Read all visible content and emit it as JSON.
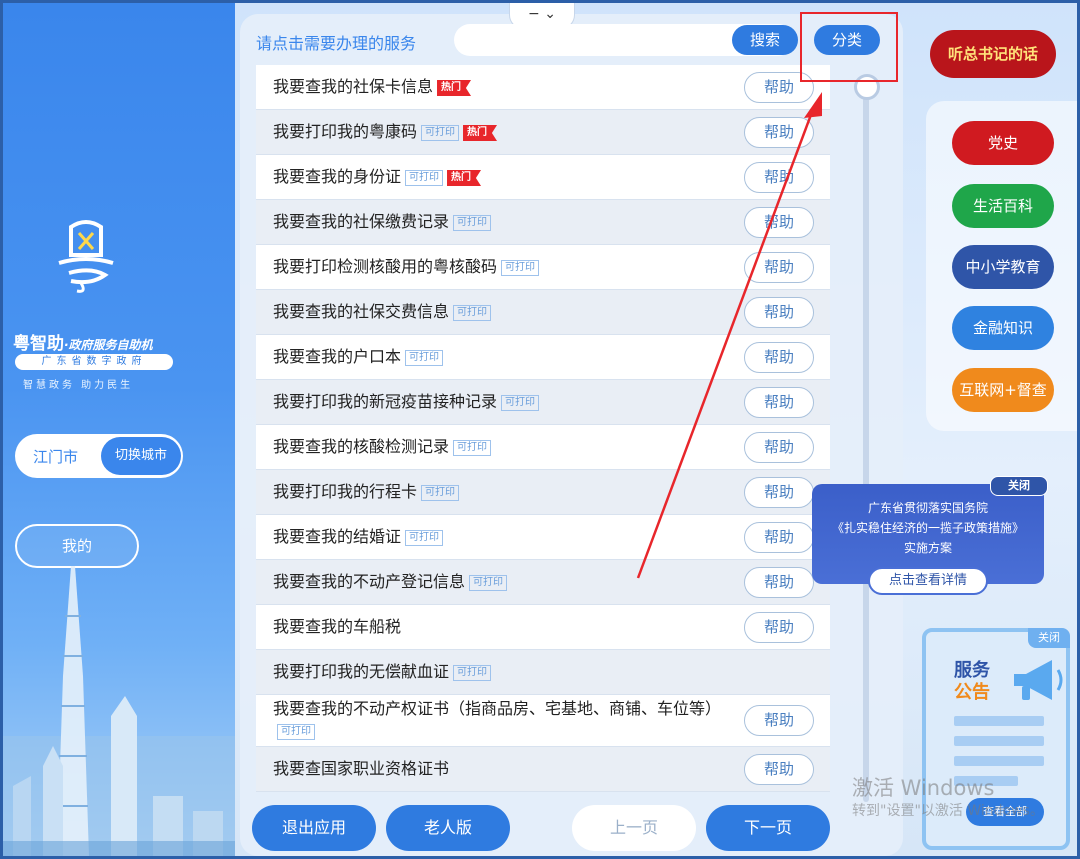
{
  "left": {
    "brand_name": "粤智助",
    "brand_suffix": "·政府服务自助机",
    "brand_sub": "广东省数字政府",
    "brand_slogan": "智慧政务  助力民生",
    "city": "江门市",
    "switch_city": "切换城市",
    "mine": "我的"
  },
  "header": {
    "collapse_glyphs": "−  ⌄",
    "prompt": "请点击需要办理的服务",
    "search_value": "",
    "search_label": "搜索",
    "category_label": "分类"
  },
  "tags": {
    "print": "可打印",
    "hot": "热门"
  },
  "help_label": "帮助",
  "services": [
    {
      "text": "我要查我的社保卡信息",
      "print": false,
      "hot": true,
      "help": true
    },
    {
      "text": "我要打印我的粤康码",
      "print": true,
      "hot": true,
      "help": true
    },
    {
      "text": "我要查我的身份证",
      "print": true,
      "hot": true,
      "help": true
    },
    {
      "text": "我要查我的社保缴费记录",
      "print": true,
      "hot": false,
      "help": true
    },
    {
      "text": "我要打印检测核酸用的粤核酸码",
      "print": true,
      "hot": false,
      "help": true
    },
    {
      "text": "我要查我的社保交费信息",
      "print": true,
      "hot": false,
      "help": true
    },
    {
      "text": "我要查我的户口本",
      "print": true,
      "hot": false,
      "help": true
    },
    {
      "text": "我要打印我的新冠疫苗接种记录",
      "print": true,
      "hot": false,
      "help": true
    },
    {
      "text": "我要查我的核酸检测记录",
      "print": true,
      "hot": false,
      "help": true
    },
    {
      "text": "我要打印我的行程卡",
      "print": true,
      "hot": false,
      "help": true
    },
    {
      "text": "我要查我的结婚证",
      "print": true,
      "hot": false,
      "help": true
    },
    {
      "text": "我要查我的不动产登记信息",
      "print": true,
      "hot": false,
      "help": true
    },
    {
      "text": "我要查我的车船税",
      "print": false,
      "hot": false,
      "help": true
    },
    {
      "text": "我要打印我的无偿献血证",
      "print": true,
      "hot": false,
      "help": false
    },
    {
      "text": "我要查我的不动产权证书（指商品房、宅基地、商铺、车位等）",
      "print": true,
      "hot": false,
      "help": true,
      "tall": true
    },
    {
      "text": "我要查国家职业资格证书",
      "print": false,
      "hot": false,
      "help": true
    }
  ],
  "footer": {
    "exit": "退出应用",
    "elder": "老人版",
    "prev": "上一页",
    "next": "下一页"
  },
  "right": {
    "xi": "听总书记的话",
    "categories": [
      "党史",
      "生活百科",
      "中小学教育",
      "金融知识",
      "互联网+督查"
    ]
  },
  "notice": {
    "close": "关闭",
    "line1": "广东省贯彻落实国务院",
    "line2": "《扎实稳住经济的一揽子政策措施》",
    "line3": "实施方案",
    "detail": "点击查看详情"
  },
  "service_card": {
    "close": "关闭",
    "title1": "服务",
    "title2": "公告",
    "view_all": "查看全部"
  },
  "watermark": {
    "line1": "激活 Windows",
    "line2": "转到\"设置\"以激活 Windows。"
  },
  "colors": {
    "primary": "#2f7be0",
    "hot": "#e8262b",
    "highlight_box": "#e8262b"
  }
}
